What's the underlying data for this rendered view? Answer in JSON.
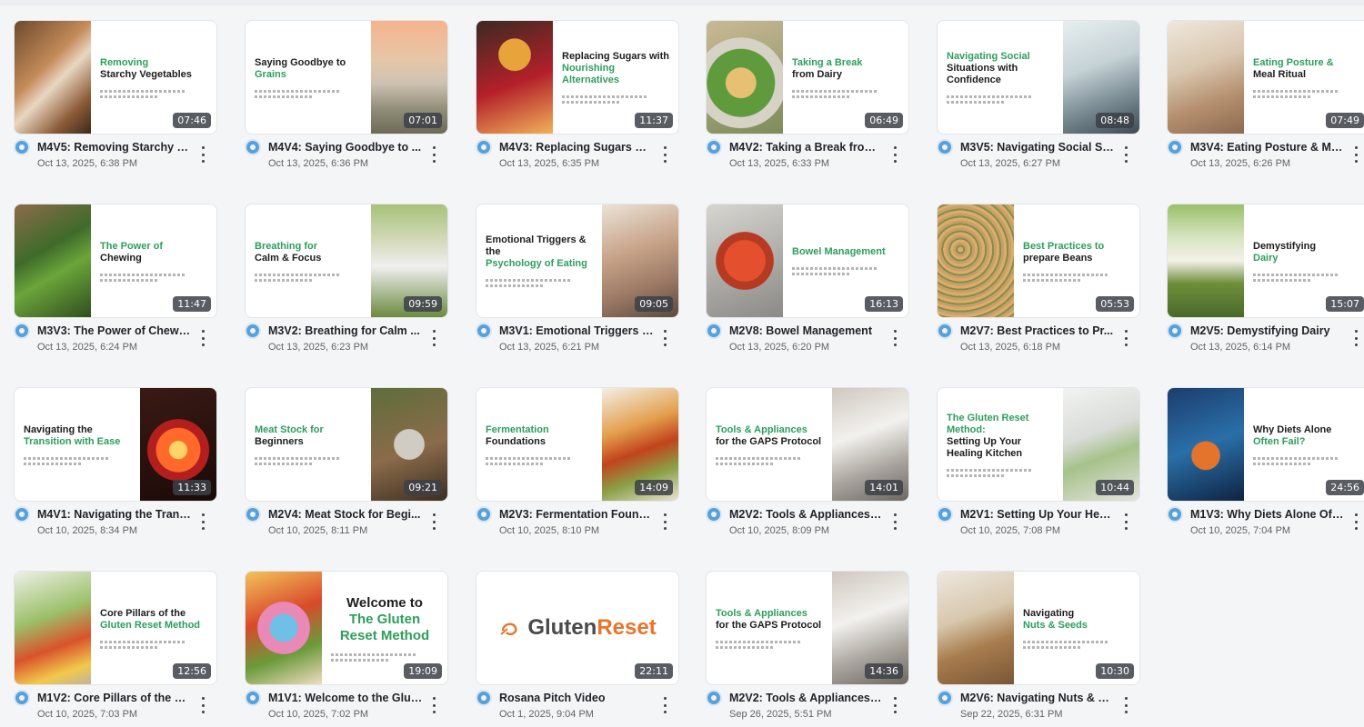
{
  "videos": [
    {
      "title": "M4V5: Removing Starchy V...",
      "date": "Oct 13, 2025, 6:38 PM",
      "duration": "07:46",
      "slide_line1": "Removing",
      "slide_line2": "Starchy Vegetables",
      "image": "sweet-potato",
      "layout": "img-left",
      "accent_first": true
    },
    {
      "title": "M4V4: Saying Goodbye to ...",
      "date": "Oct 13, 2025, 6:36 PM",
      "duration": "07:01",
      "slide_line1": "Saying Goodbye to",
      "slide_line2": "Grains",
      "image": "wheat-field",
      "layout": "img-right",
      "accent_first": false
    },
    {
      "title": "M4V3: Replacing Sugars wi...",
      "date": "Oct 13, 2025, 6:35 PM",
      "duration": "11:37",
      "slide_line1": "Replacing Sugars with",
      "slide_line2": "Nourishing Alternatives",
      "image": "honey",
      "layout": "img-left",
      "accent_first": false
    },
    {
      "title": "M4V2: Taking a Break from ...",
      "date": "Oct 13, 2025, 6:33 PM",
      "duration": "06:49",
      "slide_line1": "Taking a Break",
      "slide_line2": "from Dairy",
      "image": "salad",
      "layout": "img-left",
      "accent_first": true
    },
    {
      "title": "M3V5: Navigating Social Si...",
      "date": "Oct 13, 2025, 6:27 PM",
      "duration": "08:48",
      "slide_line1": "Navigating Social",
      "slide_line2": "Situations with Confidence",
      "image": "friends",
      "layout": "img-right",
      "accent_first": true
    },
    {
      "title": "M3V4: Eating Posture & Me...",
      "date": "Oct 13, 2025, 6:26 PM",
      "duration": "07:49",
      "slide_line1": "Eating Posture &",
      "slide_line2": "Meal Ritual",
      "image": "woman-eating",
      "layout": "img-left",
      "accent_first": true
    },
    {
      "title": "M3V3: The Power of Chewing",
      "date": "Oct 13, 2025, 6:24 PM",
      "duration": "11:47",
      "slide_line1": "The Power of",
      "slide_line2": "Chewing",
      "image": "greens",
      "layout": "img-left",
      "accent_first": true
    },
    {
      "title": "M3V2: Breathing for Calm ...",
      "date": "Oct 13, 2025, 6:23 PM",
      "duration": "09:59",
      "slide_line1": "Breathing for",
      "slide_line2": "Calm & Focus",
      "image": "meditation",
      "layout": "img-right",
      "accent_first": true
    },
    {
      "title": "M3V1: Emotional Triggers &...",
      "date": "Oct 13, 2025, 6:21 PM",
      "duration": "09:05",
      "slide_line1": "Emotional Triggers & the",
      "slide_line2": "Psychology of Eating",
      "image": "child",
      "layout": "img-right",
      "accent_first": false
    },
    {
      "title": "M2V8: Bowel Management",
      "date": "Oct 13, 2025, 6:20 PM",
      "duration": "16:13",
      "slide_line1": "Bowel Management",
      "slide_line2": "",
      "image": "gut",
      "layout": "img-left",
      "accent_first": true
    },
    {
      "title": "M2V7: Best Practices to Pr...",
      "date": "Oct 13, 2025, 6:18 PM",
      "duration": "05:53",
      "slide_line1": "Best Practices to",
      "slide_line2": "prepare Beans",
      "image": "beans",
      "layout": "img-left-wide",
      "accent_first": true
    },
    {
      "title": "M2V5: Demystifying Dairy",
      "date": "Oct 13, 2025, 6:14 PM",
      "duration": "15:07",
      "slide_line1": "Demystifying",
      "slide_line2": "Dairy",
      "image": "milk",
      "layout": "img-left",
      "accent_first": false
    },
    {
      "title": "M4V1: Navigating the Trans...",
      "date": "Oct 10, 2025, 8:34 PM",
      "duration": "11:33",
      "slide_line1": "Navigating the",
      "slide_line2": "Transition with Ease",
      "image": "glowing-gut",
      "layout": "img-right",
      "accent_first": false
    },
    {
      "title": "M2V4: Meat Stock for Begi...",
      "date": "Oct 10, 2025, 8:11 PM",
      "duration": "09:21",
      "slide_line1": "Meat Stock for",
      "slide_line2": "Beginners",
      "image": "stock-pot",
      "layout": "img-right",
      "accent_first": true
    },
    {
      "title": "M2V3: Fermentation Found...",
      "date": "Oct 10, 2025, 8:10 PM",
      "duration": "14:09",
      "slide_line1": "Fermentation",
      "slide_line2": "Foundations",
      "image": "jars",
      "layout": "img-right",
      "accent_first": true
    },
    {
      "title": "M2V2: Tools & Appliances f...",
      "date": "Oct 10, 2025, 8:09 PM",
      "duration": "14:01",
      "slide_line1": "Tools & Appliances",
      "slide_line2": "for the GAPS Protocol",
      "image": "kitchen",
      "layout": "img-right",
      "accent_first": true
    },
    {
      "title": "M2V1: Setting Up Your Heali...",
      "date": "Oct 10, 2025, 7:08 PM",
      "duration": "10:44",
      "slide_line1": "The Gluten Reset Method:",
      "slide_line2": "Setting Up Your Healing Kitchen",
      "image": "fridge",
      "layout": "img-right",
      "accent_first": true
    },
    {
      "title": "M1V3: Why Diets Alone Oft...",
      "date": "Oct 10, 2025, 7:04 PM",
      "duration": "24:56",
      "slide_line1": "Why Diets Alone",
      "slide_line2": "Often Fail?",
      "image": "body-gut",
      "layout": "img-left",
      "accent_first": false
    },
    {
      "title": "M1V2: Core Pillars of the Gl...",
      "date": "Oct 10, 2025, 7:03 PM",
      "duration": "12:56",
      "slide_line1": "Core Pillars of the",
      "slide_line2": "Gluten Reset Method",
      "image": "vegetables",
      "layout": "img-left",
      "accent_first": false
    },
    {
      "title": "M1V1: Welcome to the Glut...",
      "date": "Oct 10, 2025, 7:02 PM",
      "duration": "19:09",
      "slide_line1": "Welcome to",
      "slide_line2": "The Gluten Reset Method",
      "image": "microbiome",
      "layout": "img-left-big",
      "accent_first": false
    },
    {
      "title": "Rosana Pitch Video",
      "date": "Oct 1, 2025, 9:04 PM",
      "duration": "22:11",
      "slide_line1": "Gluten",
      "slide_line2": "Reset",
      "image": "logo",
      "layout": "logo",
      "accent_first": false
    },
    {
      "title": "M2V2: Tools & Appliances f...",
      "date": "Sep 26, 2025, 5:51 PM",
      "duration": "14:36",
      "slide_line1": "Tools & Appliances",
      "slide_line2": "for the GAPS Protocol",
      "image": "kitchen",
      "layout": "img-right",
      "accent_first": true
    },
    {
      "title": "M2V6: Navigating Nuts & S...",
      "date": "Sep 22, 2025, 6:31 PM",
      "duration": "10:30",
      "slide_line1": "Navigating",
      "slide_line2": "Nuts & Seeds",
      "image": "nuts",
      "layout": "img-left",
      "accent_first": false
    }
  ],
  "colors": {
    "accent_green": "#2e9d5d",
    "logo_orange": "#e9742b",
    "duration_bg": "#3c4048"
  }
}
